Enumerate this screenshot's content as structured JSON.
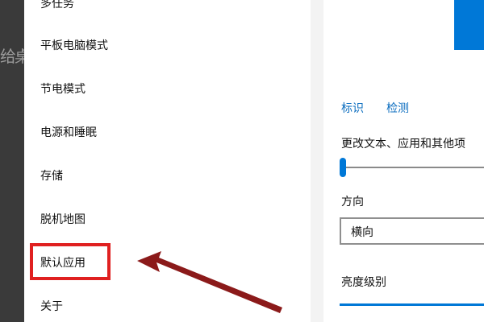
{
  "background": {
    "ghost_text": "给桌"
  },
  "sidebar": {
    "items": [
      {
        "label": "多任务"
      },
      {
        "label": "平板电脑模式"
      },
      {
        "label": "节电模式"
      },
      {
        "label": "电源和睡眠"
      },
      {
        "label": "存储"
      },
      {
        "label": "脱机地图"
      },
      {
        "label": "默认应用"
      },
      {
        "label": "关于"
      }
    ],
    "highlighted_item": "默认应用"
  },
  "display": {
    "identify_link": "标识",
    "detect_link": "检测",
    "scale_label": "更改文本、应用和其他项",
    "orientation_label": "方向",
    "orientation_value": "横向",
    "brightness_label": "亮度级别"
  },
  "colors": {
    "accent": "#0078d7",
    "annotation_red": "#e02020",
    "arrow": "#8b1a1a"
  }
}
